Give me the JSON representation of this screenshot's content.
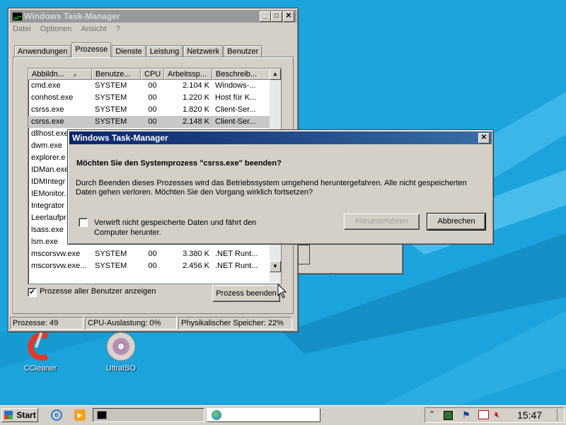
{
  "taskmgr": {
    "title": "Windows Task-Manager",
    "menu": [
      "Datei",
      "Optionen",
      "Ansicht",
      "?"
    ],
    "tabs": [
      "Anwendungen",
      "Prozesse",
      "Dienste",
      "Leistung",
      "Netzwerk",
      "Benutzer"
    ],
    "selected_tab": "Prozesse",
    "columns": [
      "Abbildn...",
      "Benutze...",
      "CPU",
      "Arbeitssp...",
      "Beschreib..."
    ],
    "rows": [
      [
        "cmd.exe",
        "SYSTEM",
        "00",
        "2.104 K",
        "Windows-..."
      ],
      [
        "conhost.exe",
        "SYSTEM",
        "00",
        "1.220 K",
        "Host für K..."
      ],
      [
        "csrss.exe",
        "SYSTEM",
        "00",
        "1.820 K",
        "Client-Ser..."
      ],
      [
        "csrss.exe",
        "SYSTEM",
        "00",
        "2.148 K",
        "Client-Ser..."
      ],
      [
        "dllhost.exe",
        "",
        "",
        "",
        ""
      ],
      [
        "dwm.exe",
        "",
        "",
        "",
        ""
      ],
      [
        "explorer.e",
        "",
        "",
        "",
        ""
      ],
      [
        "IDMan.exe",
        "",
        "",
        "",
        ""
      ],
      [
        "IDMIntegr",
        "",
        "",
        "",
        ""
      ],
      [
        "IEMonitor.",
        "",
        "",
        "",
        ""
      ],
      [
        "Integrator",
        "",
        "",
        "",
        ""
      ],
      [
        "Leerlaufpr",
        "",
        "",
        "",
        ""
      ],
      [
        "lsass.exe",
        "",
        "",
        "",
        ""
      ],
      [
        "lsm.exe",
        "",
        "",
        "",
        ""
      ],
      [
        "mscorsvw.exe",
        "SYSTEM",
        "00",
        "3.380 K",
        ".NET Runt..."
      ],
      [
        "mscorsvw.exe...",
        "SYSTEM",
        "00",
        "2.456 K",
        ".NET Runt..."
      ]
    ],
    "show_all_label": "Prozesse aller Benutzer anzeigen",
    "end_process_label": "Prozess beenden",
    "status": {
      "processes": "Prozesse: 49",
      "cpu": "CPU-Auslastung: 0%",
      "memory": "Physikalischer Speicher: 22%"
    }
  },
  "dialog": {
    "title": "Windows Task-Manager",
    "question": "Möchten Sie den Systemprozess \"csrss.exe\" beenden?",
    "body": "Durch Beenden dieses Prozesses wird das Betriebssystem umgehend heruntergefahren. Alle nicht gespeicherten Daten gehen verloren. Möchten Sie den Vorgang wirklich fortsetzen?",
    "checkbox_label": "Verwirft nicht gespeicherte Daten und fährt den Computer herunter.",
    "shutdown_label": "Herunterfahren",
    "cancel_label": "Abbrechen",
    "close_glyph": "✕"
  },
  "desktop": {
    "icons": [
      "CCleaner",
      "UltraISO"
    ]
  },
  "taskbar": {
    "start_label": "Start",
    "clock": "15:47"
  },
  "titlebar_buttons": [
    "_",
    "□",
    "✕"
  ]
}
